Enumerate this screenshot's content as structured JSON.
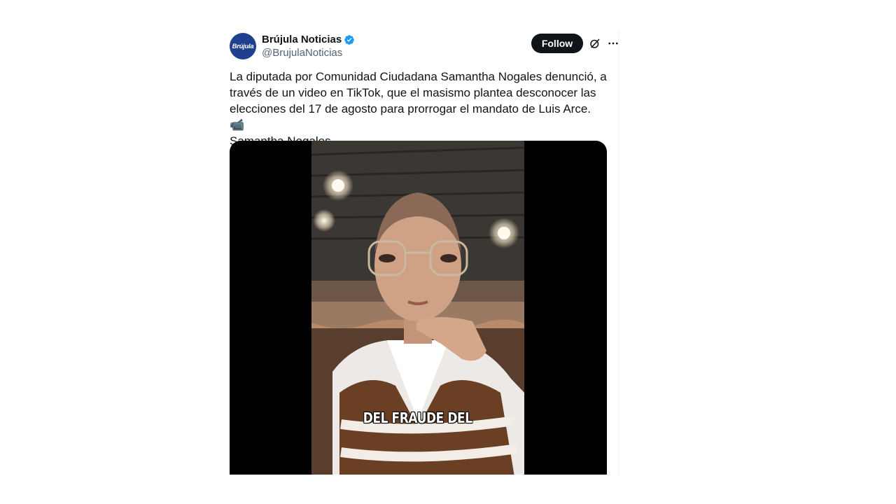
{
  "tweet": {
    "author": {
      "display_name": "Brújula Noticias",
      "handle": "@BrujulaNoticias",
      "avatar_text": "Brújula",
      "verified": true
    },
    "follow_label": "Follow",
    "text_main": "La diputada por Comunidad Ciudadana Samantha Nogales denunció, a través de un video en TikTok, que el masismo plantea desconocer las elecciones del 17 de agosto para prorrogar el mandato de Luis Arce.",
    "text_emoji": "📹",
    "text_after": "Samantha Nogales",
    "media": {
      "caption": "DEL FRAUDE DEL"
    }
  },
  "colors": {
    "verified": "#1d9bf0",
    "follow_bg": "#0f1419",
    "handle": "#536471",
    "avatar_bg": "#1f3f8f"
  },
  "icons": [
    "verified-badge-icon",
    "grok-icon",
    "more-icon"
  ]
}
